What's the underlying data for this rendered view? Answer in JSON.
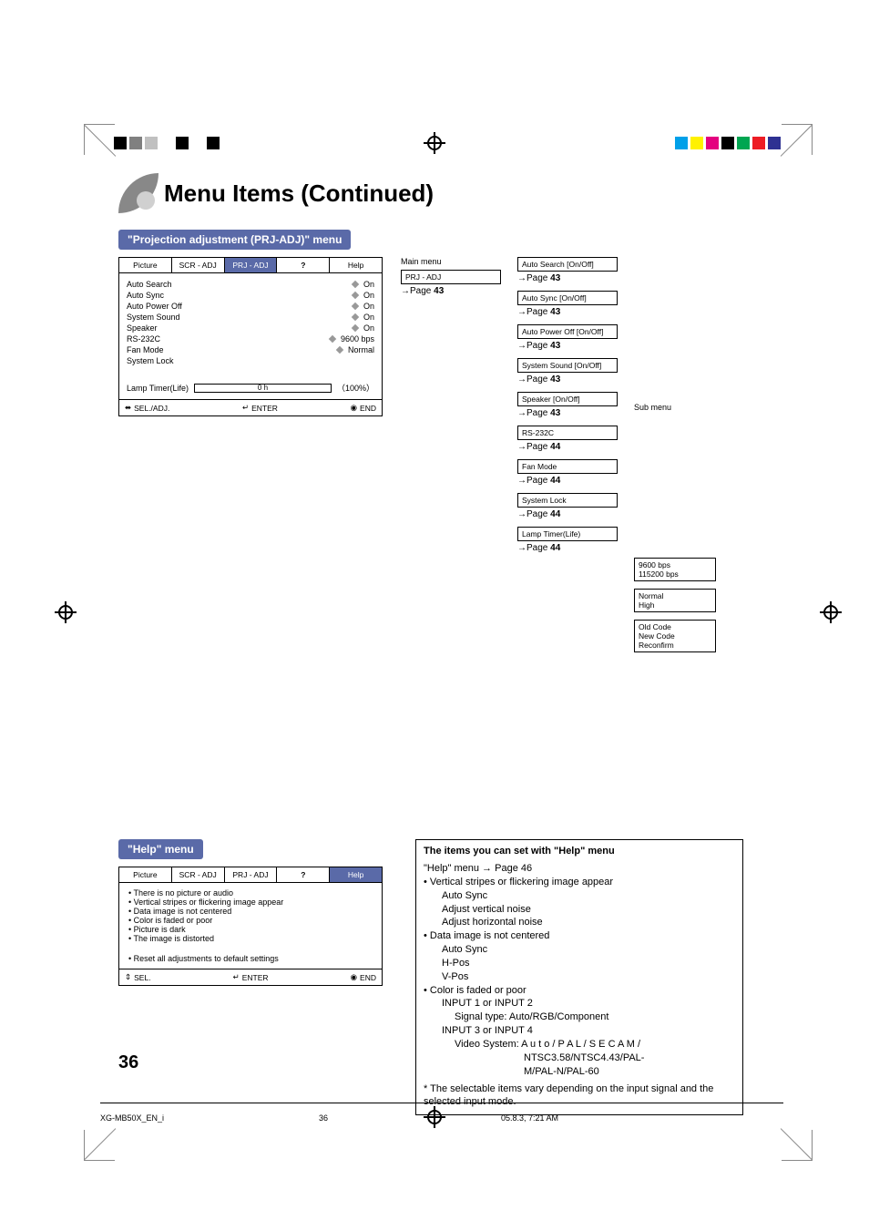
{
  "registration": {
    "left_colors": [
      "#000000",
      "#808080",
      "#c0c0c0",
      "#ffffff",
      "#000000",
      "#ffffff",
      "#000000",
      "#ffffff"
    ],
    "right_colors": [
      "#00a0e9",
      "#fff100",
      "#e4007f",
      "#000000",
      "#00a651",
      "#ed1c24",
      "#2e3192",
      "#ffffff"
    ]
  },
  "title": "Menu Items (Continued)",
  "prj_section_label": "\"Projection adjustment (PRJ-ADJ)\" menu",
  "osd_prj": {
    "tabs": [
      "Picture",
      "SCR - ADJ",
      "PRJ - ADJ",
      "?",
      "Help"
    ],
    "active_tab_index": 2,
    "rows": [
      {
        "label": "Auto Search",
        "value": "On"
      },
      {
        "label": "Auto Sync",
        "value": "On"
      },
      {
        "label": "Auto Power Off",
        "value": "On"
      },
      {
        "label": "System Sound",
        "value": "On"
      },
      {
        "label": "Speaker",
        "value": "On"
      },
      {
        "label": "RS-232C",
        "value": "9600 bps"
      },
      {
        "label": "Fan Mode",
        "value": "Normal"
      },
      {
        "label": "System Lock",
        "value": ""
      }
    ],
    "lamp_label": "Lamp Timer(Life)",
    "lamp_hours": "0",
    "lamp_unit": "h",
    "lamp_pct": "100%",
    "footer": {
      "sel": "SEL./ADJ.",
      "enter": "ENTER",
      "end": "END"
    }
  },
  "tree": {
    "main_label": "Main menu",
    "sub_label": "Sub menu",
    "root": {
      "label": "PRJ - ADJ",
      "page": "43"
    },
    "mid": [
      {
        "label": "Auto Search [On/Off]",
        "page": "43"
      },
      {
        "label": "Auto Sync [On/Off]",
        "page": "43"
      },
      {
        "label": "Auto Power Off [On/Off]",
        "page": "43"
      },
      {
        "label": "System Sound [On/Off]",
        "page": "43"
      },
      {
        "label": "Speaker [On/Off]",
        "page": "43"
      },
      {
        "label": "RS-232C",
        "page": "44",
        "sub": [
          "9600 bps",
          "115200 bps"
        ]
      },
      {
        "label": "Fan Mode",
        "page": "44",
        "sub": [
          "Normal",
          "High"
        ]
      },
      {
        "label": "System Lock",
        "page": "44",
        "sub": [
          "Old Code",
          "New Code",
          "Reconfirm"
        ]
      },
      {
        "label": "Lamp Timer(Life)",
        "page": "44"
      }
    ],
    "page_prefix": "Page "
  },
  "help_label": "\"Help\" menu",
  "osd_help": {
    "tabs": [
      "Picture",
      "SCR - ADJ",
      "PRJ - ADJ",
      "?",
      "Help"
    ],
    "active_tab_index": 4,
    "items": [
      "There is no picture or audio",
      "Vertical stripes or flickering image appear",
      "Data image is not centered",
      "Color is faded or poor",
      "Picture is dark",
      "The image is distorted"
    ],
    "reset": "Reset all adjustments to default settings",
    "footer": {
      "sel": "SEL.",
      "enter": "ENTER",
      "end": "END"
    }
  },
  "help_items_box": {
    "title": "The items you can set with \"Help\" menu",
    "intro": "\"Help\" menu → Page 46",
    "b1": "Vertical stripes or flickering image appear",
    "b1s": [
      "Auto Sync",
      "Adjust vertical noise",
      "Adjust horizontal noise"
    ],
    "b2": "Data image is not centered",
    "b2s": [
      "Auto Sync",
      "H-Pos",
      "V-Pos"
    ],
    "b3": "Color is faded or poor",
    "b3_l1": "INPUT 1 or INPUT 2",
    "b3_l1s": "Signal type: Auto/RGB/Component",
    "b3_l2": "INPUT 3 or INPUT 4",
    "b3_l2s1": "Video System: A u t o / P A L / S E C A M /",
    "b3_l2s2": "NTSC3.58/NTSC4.43/PAL-",
    "b3_l2s3": "M/PAL-N/PAL-60",
    "note": "* The selectable items vary depending on the input signal and the selected input mode."
  },
  "page_number": "36",
  "footer": {
    "file": "XG-MB50X_EN_i",
    "page": "36",
    "timestamp": "05.8.3, 7:21 AM"
  }
}
